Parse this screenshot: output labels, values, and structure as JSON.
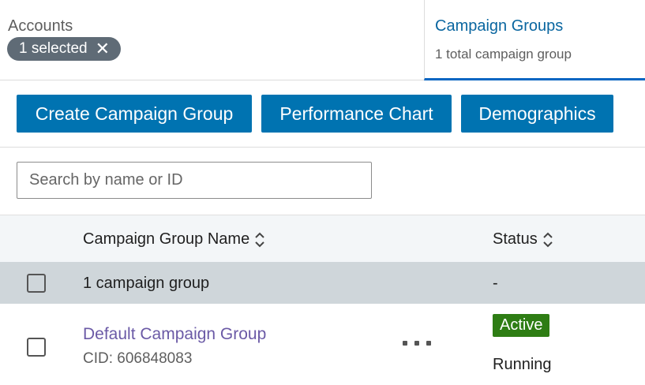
{
  "accounts": {
    "label": "Accounts",
    "selected_label": "1 selected",
    "clear_symbol": "✕"
  },
  "tab": {
    "title": "Campaign Groups",
    "subtitle": "1 total campaign group"
  },
  "toolbar": {
    "create_label": "Create Campaign Group",
    "chart_label": "Performance Chart",
    "demographics_label": "Demographics"
  },
  "search": {
    "placeholder": "Search by name or ID",
    "value": ""
  },
  "table": {
    "columns": {
      "name": "Campaign Group Name",
      "status": "Status"
    },
    "group_row": {
      "label": "1 campaign group",
      "status": "-"
    },
    "rows": [
      {
        "name": "Default Campaign Group",
        "cid": "CID: 606848083",
        "badge": "Active",
        "status_text": "Running"
      }
    ]
  },
  "colors": {
    "primary": "#0073b1",
    "active_badge": "#2e7d14",
    "link": "#6b5aa6",
    "tab_underline": "#0a66c2"
  },
  "icons": {
    "sort": "sort-icon",
    "clear": "close-icon",
    "more": "more-options-icon"
  }
}
